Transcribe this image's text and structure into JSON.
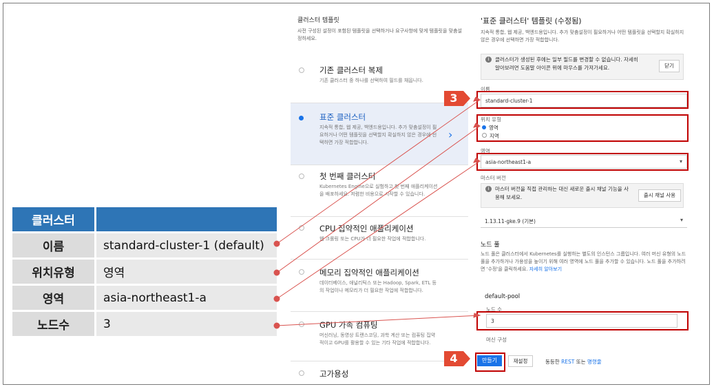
{
  "summary_table": {
    "header": [
      "클러스터",
      ""
    ],
    "rows": [
      {
        "key": "이름",
        "value": "standard-cluster-1 (default)"
      },
      {
        "key": "위치유형",
        "value": "영역"
      },
      {
        "key": "영역",
        "value": "asia-northeast1-a"
      },
      {
        "key": "노드수",
        "value": "3"
      }
    ]
  },
  "templates": {
    "title": "클러스터 템플릿",
    "description": "사전 구성된 설정이 포함된 템플릿을 선택하거나 요구사항에 맞게 템플릿을 맞춤설정하세요.",
    "options": [
      {
        "name": "기존 클러스터 복제",
        "desc": "기존 클러스터 중 하나를 선택하여 필드를 채웁니다."
      },
      {
        "name": "표준 클러스터",
        "desc": "지속적 통합, 웹 제공, 백엔드용입니다. 추가 맞춤설정이 필요하거나 어떤 템플릿을 선택할지 확실하지 않은 경우에 선택하면 가장 적합합니다."
      },
      {
        "name": "첫 번째 클러스터",
        "desc": "Kubernetes Engine으로 실험하고 첫 번째 애플리케이션을 배포하세요. 저렴한 비용으로 시작할 수 있습니다."
      },
      {
        "name": "CPU 집약적인 애플리케이션",
        "desc": "웹 크롤링 또는 CPU가 더 필요한 작업에 적합합니다."
      },
      {
        "name": "메모리 집약적인 애플리케이션",
        "desc": "데이터베이스, 애널리틱스 또는 Hadoop, Spark, ETL 등의 작업이나 메모리가 더 필요한 작업에 적합합니다."
      },
      {
        "name": "GPU 가속 컴퓨팅",
        "desc": "머신러닝, 동영상 트랜스코딩, 과학 계산 또는 컴퓨팅 집약적이고 GPU를 활용할 수 있는 기타 작업에 적합합니다."
      },
      {
        "name": "고가용성",
        "desc": ""
      }
    ]
  },
  "form": {
    "title": "'표준 클러스터' 템플릿 (수정됨)",
    "description": "지속적 통합, 웹 제공, 백엔드용입니다. 추가 맞춤설정이 필요하거나 어떤 템플릿을 선택할지 확실하지 않은 경우에 선택하면 가장 적합합니다.",
    "info_notice": "클러스터가 생성된 후에는 일부 필드를 변경할 수 없습니다. 자세히 알아보려면 도움말 아이콘 위에 마우스를 가져가세요.",
    "close_label": "닫기",
    "name_label": "이름",
    "name_value": "standard-cluster-1",
    "location_type_label": "위치 유형",
    "location_zone": "영역",
    "location_region": "지역",
    "zone_label": "영역",
    "zone_value": "asia-northeast1-a",
    "master_version_label": "마스터 버전",
    "master_notice": "마스터 버전을 직접 관리하는 대신 새로운 출시 채널 기능을 사용해 보세요.",
    "release_channel_label": "출시 채널 사용",
    "version_value": "1.13.11-gke.9 (기본)",
    "node_pool_title": "노드 풀",
    "node_pool_desc": "노드 풀은 클러스터에서 Kubernetes를 실행하는 별도의 인스턴스 그룹입니다. 여러 머신 유형의 노드 풀을 추가하거나 가용성을 높이기 위해 여러 영역에 노드 풀을 추가할 수 있습니다. 노드 풀을 추가하려면 '수정'을 클릭하세요.",
    "learn_more": "자세히 알아보기",
    "pool_name": "default-pool",
    "node_count_label": "노드 수",
    "node_count_value": "3",
    "machine_config_label": "머신 구성",
    "create_label": "만들기",
    "reset_label": "재설정",
    "equivalent_text": "동등한",
    "rest_link": "REST",
    "or_text": "또는",
    "cli_link": "명령줄"
  },
  "markers": {
    "step3": "3",
    "step4": "4"
  },
  "colors": {
    "table_header": "#2e75b6",
    "highlight": "#c00000",
    "marker": "#e34a33",
    "accent": "#1a73e8"
  }
}
